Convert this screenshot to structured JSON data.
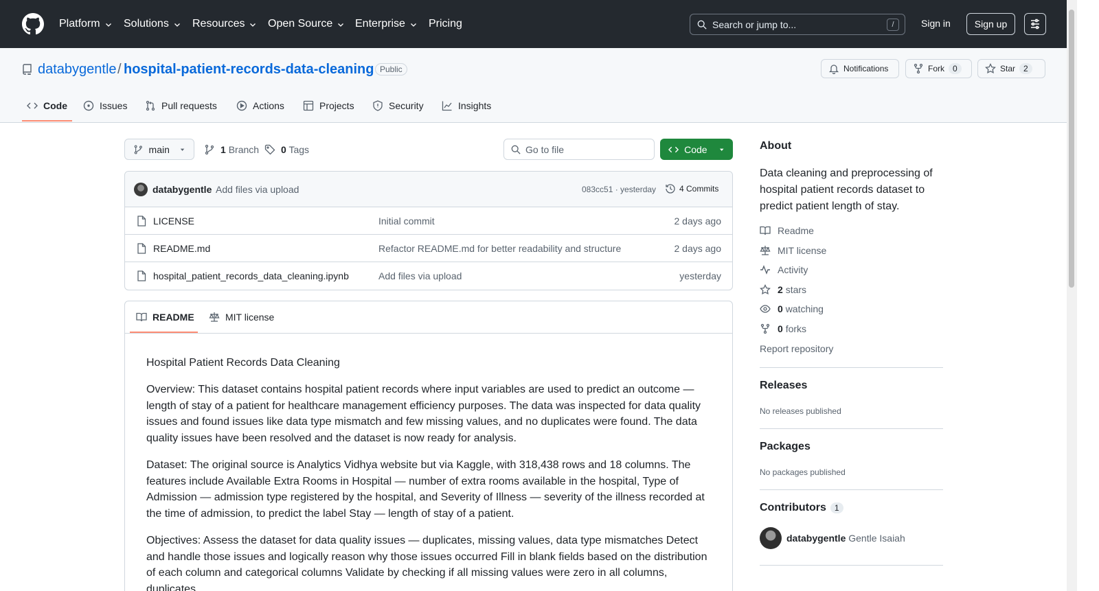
{
  "header": {
    "nav": [
      {
        "label": "Platform",
        "has_dropdown": true
      },
      {
        "label": "Solutions",
        "has_dropdown": true
      },
      {
        "label": "Resources",
        "has_dropdown": true
      },
      {
        "label": "Open Source",
        "has_dropdown": true
      },
      {
        "label": "Enterprise",
        "has_dropdown": true
      },
      {
        "label": "Pricing",
        "has_dropdown": false
      }
    ],
    "search_placeholder": "Search or jump to...",
    "search_shortcut": "/",
    "sign_in": "Sign in",
    "sign_up": "Sign up"
  },
  "repo": {
    "owner": "databygentle",
    "separator": "/",
    "name": "hospital-patient-records-data-cleaning",
    "visibility": "Public",
    "notifications_label": "Notifications",
    "fork_label": "Fork",
    "fork_count": "0",
    "star_label": "Star",
    "star_count": "2"
  },
  "tabs": [
    {
      "label": "Code",
      "icon": "code-icon",
      "active": true
    },
    {
      "label": "Issues",
      "icon": "issue-icon"
    },
    {
      "label": "Pull requests",
      "icon": "pull-request-icon"
    },
    {
      "label": "Actions",
      "icon": "play-icon"
    },
    {
      "label": "Projects",
      "icon": "table-icon"
    },
    {
      "label": "Security",
      "icon": "shield-icon"
    },
    {
      "label": "Insights",
      "icon": "graph-icon"
    }
  ],
  "toolbar": {
    "branch": "main",
    "branch_count": "1",
    "branch_label": "Branch",
    "tag_count": "0",
    "tag_label": "Tags",
    "go_to_file": "Go to file",
    "code_button": "Code"
  },
  "commit": {
    "author": "databygentle",
    "message": "Add files via upload",
    "hash_time": "083cc51 · yesterday",
    "commits_label": "4 Commits"
  },
  "files": [
    {
      "name": "LICENSE",
      "message": "Initial commit",
      "age": "2 days ago"
    },
    {
      "name": "README.md",
      "message": "Refactor README.md for better readability and structure",
      "age": "2 days ago"
    },
    {
      "name": "hospital_patient_records_data_cleaning.ipynb",
      "message": "Add files via upload",
      "age": "yesterday"
    }
  ],
  "readme_tabs": {
    "readme": "README",
    "license": "MIT license"
  },
  "readme": {
    "title": "Hospital Patient Records Data Cleaning",
    "p1": "Overview: This dataset contains hospital patient records where input variables are used to predict an outcome — length of stay of a patient for healthcare management efficiency purposes. The data was inspected for data quality issues and found issues like data type mismatch and few missing values, and no duplicates were found. The data quality issues have been resolved and the dataset is now ready for analysis.",
    "p2": "Dataset: The original source is Analytics Vidhya website but via Kaggle, with 318,438 rows and 18 columns. The features include Available Extra Rooms in Hospital — number of extra rooms available in the hospital, Type of Admission — admission type registered by the hospital, and Severity of Illness — severity of the illness recorded at the time of admission, to predict the label Stay — length of stay of a patient.",
    "p3": "Objectives: Assess the dataset for data quality issues — duplicates, missing values, data type mismatches Detect and handle those issues and logically reason why those issues occurred Fill in blank fields based on the distribution of each column and categorical columns Validate by checking if all missing values were zero in all columns, duplicates"
  },
  "about": {
    "heading": "About",
    "description": "Data cleaning and preprocessing of hospital patient records dataset to predict patient length of stay.",
    "readme": "Readme",
    "license": "MIT license",
    "activity": "Activity",
    "stars_count": "2",
    "stars_label": "stars",
    "watching_count": "0",
    "watching_label": "watching",
    "forks_count": "0",
    "forks_label": "forks",
    "report": "Report repository"
  },
  "releases": {
    "heading": "Releases",
    "empty": "No releases published"
  },
  "packages": {
    "heading": "Packages",
    "empty": "No packages published"
  },
  "contributors": {
    "heading": "Contributors",
    "count": "1",
    "login": "databygentle",
    "name": "Gentle Isaiah"
  },
  "colors": {
    "header_bg": "#24292f",
    "link": "#0969da",
    "code_button": "#1f883d",
    "tab_underline": "#fd8c73"
  }
}
